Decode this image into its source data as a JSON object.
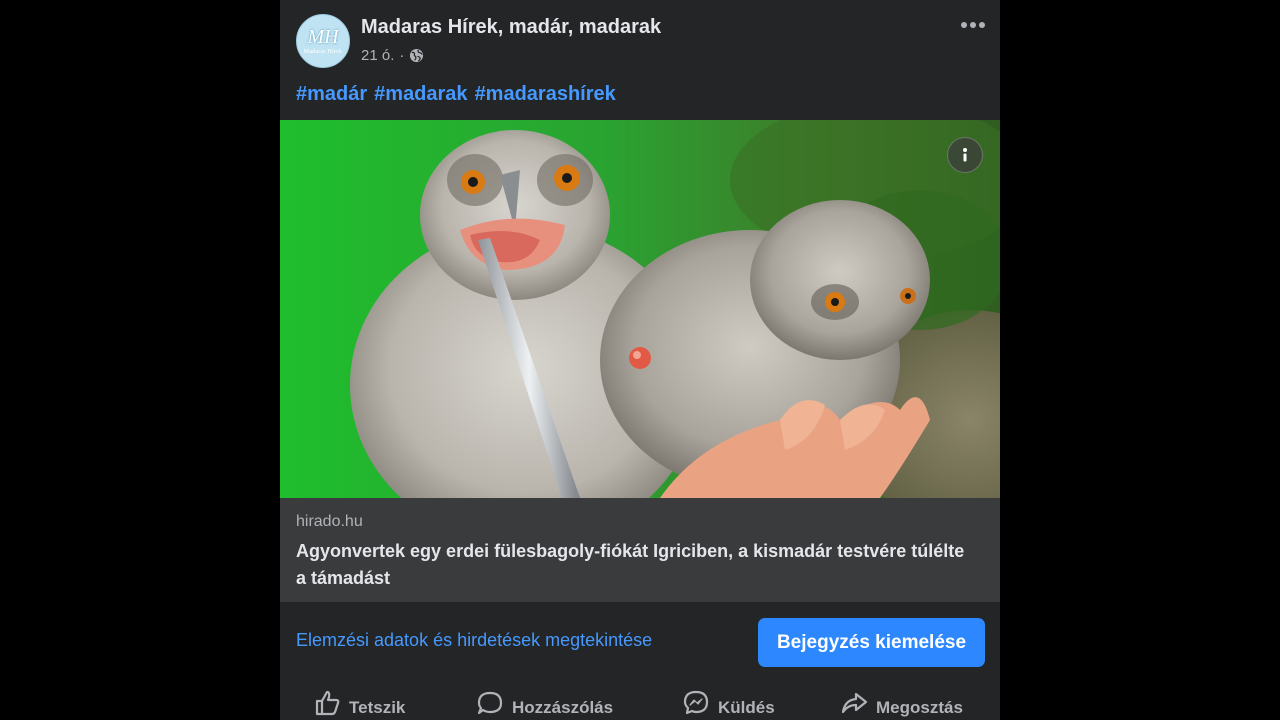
{
  "post": {
    "page_name": "Madaras Hírek, madár, madarak",
    "avatar_monogram": "MH",
    "avatar_subtext": "Madaras Hírek",
    "time": "21 ó.",
    "separator": "·",
    "audience_icon": "globe-icon",
    "more_icon": "more-dots-icon",
    "hashtags": [
      "#madár",
      "#madarak",
      "#madarashírek"
    ]
  },
  "photo": {
    "alt": "owl chicks",
    "info_icon": "info-icon"
  },
  "link_card": {
    "domain": "hirado.hu",
    "title": "Agyonvertek egy erdei fülesbagoly-fiókát Igriciben, a kismadár testvére túlélte a támadást"
  },
  "insights_link": "Elemzési adatok és hirdetések megtekintése",
  "boost_button": "Bejegyzés kiemelése",
  "actions": [
    {
      "label": "Tetszik",
      "icon": "like-icon"
    },
    {
      "label": "Hozzászólás",
      "icon": "comment-icon"
    },
    {
      "label": "Küldés",
      "icon": "messenger-icon"
    },
    {
      "label": "Megosztás",
      "icon": "share-icon"
    }
  ],
  "colors": {
    "background": "#000000",
    "card": "#242526",
    "link_card": "#3a3b3c",
    "accent": "#2d88ff",
    "link_text": "#4599ff",
    "primary_text": "#e4e6eb",
    "secondary_text": "#b0b3b8"
  }
}
